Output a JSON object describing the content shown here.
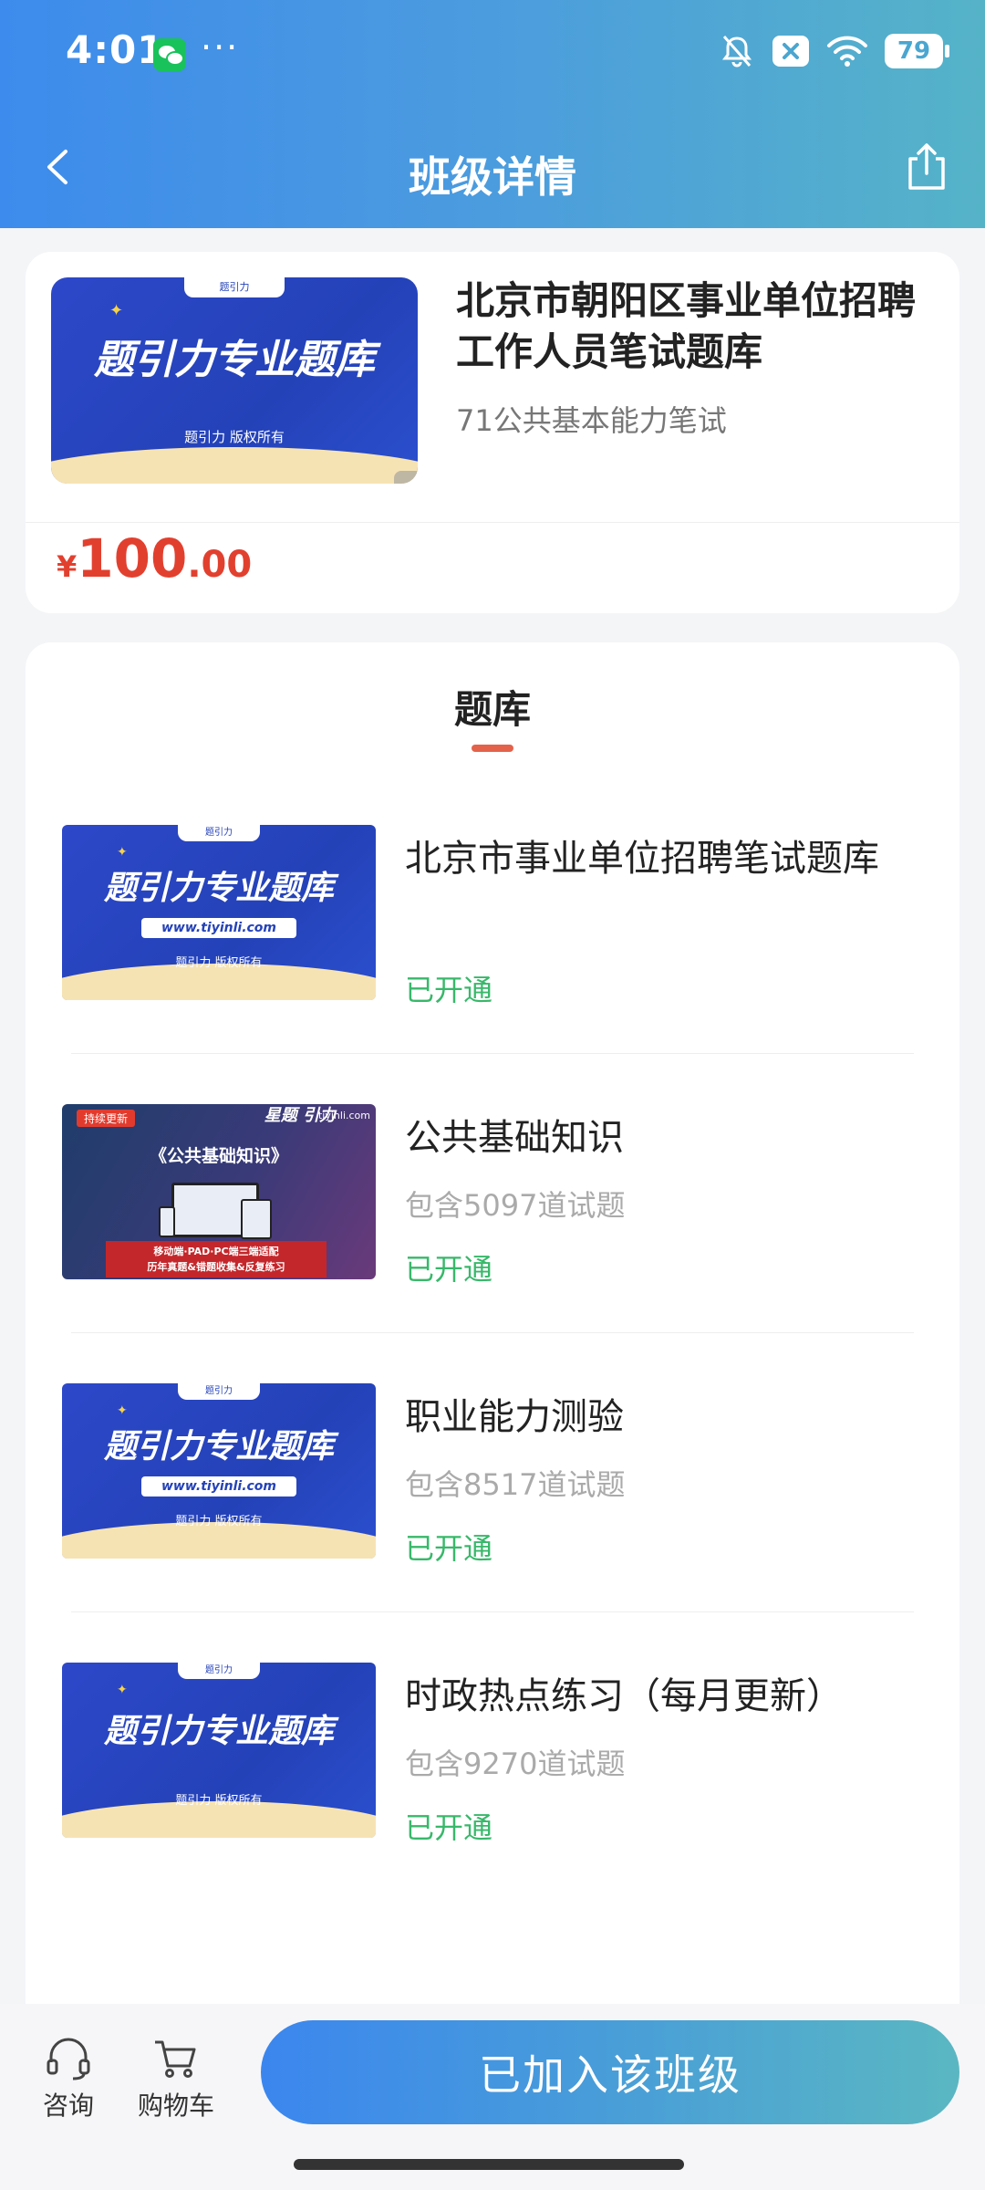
{
  "status_bar": {
    "time": "4:01",
    "dots": "···",
    "battery": "79",
    "icons": [
      "wechat-icon",
      "mute-bell-icon",
      "close-notification-icon",
      "wifi-icon",
      "battery-icon"
    ]
  },
  "nav": {
    "title": "班级详情",
    "back_icon": "chevron-left-icon",
    "share_icon": "share-icon"
  },
  "course": {
    "title": "北京市朝阳区事业单位招聘工作人员笔试题库",
    "subtitle": "71公共基本能力笔试",
    "price_currency": "¥",
    "price_integer": "100",
    "price_decimal": ".00",
    "cover": {
      "tab_text": "题引力",
      "main_text": "题引力专业题库",
      "footer_text": "题引力 版权所有"
    }
  },
  "library": {
    "tab_label": "题库",
    "items": [
      {
        "title": "北京市事业单位招聘笔试题库",
        "count": "",
        "status": "已开通",
        "cover": {
          "tab_text": "题引力",
          "main_text": "题引力专业题库",
          "url": "www.tiyinli.com",
          "footer_text": "题引力 版权所有"
        }
      },
      {
        "title": "公共基础知识",
        "count": "包含5097道试题",
        "status": "已开通",
        "cover": {
          "badge": "持续更新",
          "logo": "星题 引力",
          "url": "tiyinli.com",
          "title": "《公共基础知识》",
          "bottom_line1": "移动端·PAD·PC端三端适配",
          "bottom_line2": "历年真题&错题收集&反复练习"
        }
      },
      {
        "title": "职业能力测验",
        "count": "包含8517道试题",
        "status": "已开通",
        "cover": {
          "tab_text": "题引力",
          "main_text": "题引力专业题库",
          "url": "www.tiyinli.com",
          "footer_text": "题引力 版权所有"
        }
      },
      {
        "title": "时政热点练习（每月更新）",
        "count": "包含9270道试题",
        "status": "已开通",
        "cover": {
          "tab_text": "题引力",
          "main_text": "题引力专业题库",
          "footer_text": "题引力 版权所有"
        }
      }
    ]
  },
  "bottom_bar": {
    "consult_label": "咨询",
    "cart_label": "购物车",
    "join_button": "已加入该班级"
  },
  "colors": {
    "header_start": "#3d8bec",
    "header_end": "#55b3c8",
    "price": "#e2402f",
    "status_green": "#38b86a",
    "tab_indicator": "#e4624a"
  }
}
